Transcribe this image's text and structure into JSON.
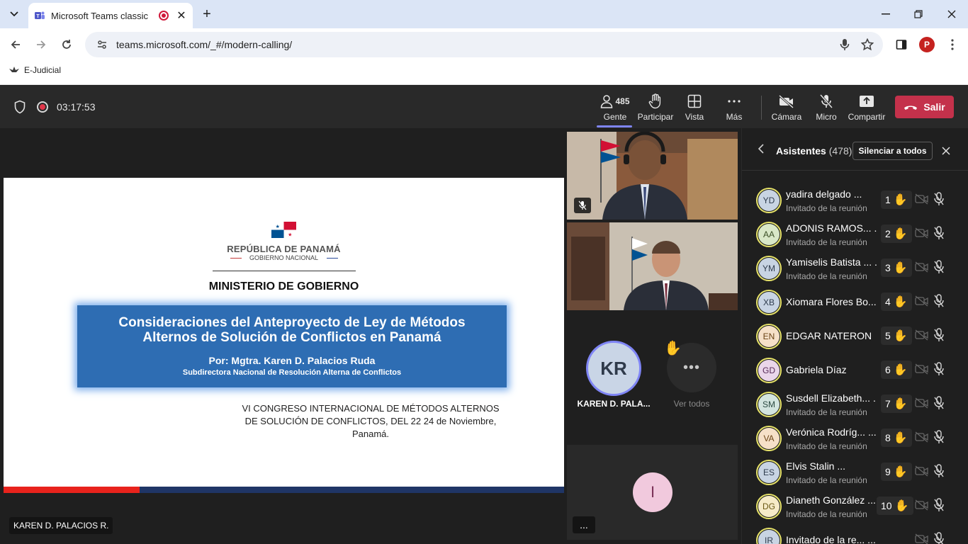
{
  "browser": {
    "tab_title": "Microsoft Teams classic",
    "url": "teams.microsoft.com/_#/modern-calling/",
    "profile_initial": "P",
    "bookmark_label": "E-Judicial"
  },
  "meeting_bar": {
    "timer": "03:17:53",
    "people_count": "485",
    "buttons": {
      "gente": "Gente",
      "participar": "Participar",
      "vista": "Vista",
      "mas": "Más",
      "camara": "Cámara",
      "micro": "Micro",
      "compartir": "Compartir",
      "salir": "Salir"
    }
  },
  "slide": {
    "republica": "REPÚBLICA DE PANAMÁ",
    "gobierno": "GOBIERNO NACIONAL",
    "ministerio": "MINISTERIO DE GOBIERNO",
    "title_line1": "Consideraciones del Anteproyecto de Ley de Métodos",
    "title_line2": "Alternos de Solución de Conflictos en Panamá",
    "author": "Por: Mgtra. Karen D. Palacios Ruda",
    "role": "Subdirectora Nacional de Resolución Alterna de Conflictos",
    "congreso_line1": "VI CONGRESO INTERNACIONAL DE MÉTODOS ALTERNOS",
    "congreso_line2": "DE SOLUCIÓN DE CONFLICTOS, DEL 22 24 de Noviembre,",
    "congreso_line3": "Panamá."
  },
  "presenter_label": "KAREN D. PALACIOS R.",
  "gallery": {
    "kr_initials": "KR",
    "kr_name": "KAREN D. PALA...",
    "ver_todos": "Ver todos",
    "i_initial": "I",
    "more_label": "..."
  },
  "panel": {
    "title": "Asistentes",
    "count": "(478)",
    "mute_all": "Silenciar a todos",
    "attendees": [
      {
        "initials": "YD",
        "name": "yadira delgado ...",
        "sub": "Invitado de la reunión",
        "hand": "1",
        "bg": "#c8d4e3",
        "fg": "#2f3c4d"
      },
      {
        "initials": "AA",
        "name": "ADONIS RAMOS... ...",
        "sub": "Invitado de la reunión",
        "hand": "2",
        "bg": "#d9e8c8",
        "fg": "#3b4f26"
      },
      {
        "initials": "YM",
        "name": "Yamiselis Batista ... ...",
        "sub": "Invitado de la reunión",
        "hand": "3",
        "bg": "#c8d4e3",
        "fg": "#2f3c4d"
      },
      {
        "initials": "XB",
        "name": "Xiomara Flores Bo...",
        "sub": "",
        "hand": "4",
        "bg": "#c8d4e3",
        "fg": "#2f3c4d"
      },
      {
        "initials": "EN",
        "name": "EDGAR NATERON",
        "sub": "",
        "hand": "5",
        "bg": "#f6e0c8",
        "fg": "#6b4416"
      },
      {
        "initials": "GD",
        "name": "Gabriela Díaz",
        "sub": "",
        "hand": "6",
        "bg": "#ead6ea",
        "fg": "#5a2d5a"
      },
      {
        "initials": "SM",
        "name": "Susdell Elizabeth... ...",
        "sub": "Invitado de la reunión",
        "hand": "7",
        "bg": "#d3e4df",
        "fg": "#2c4a42"
      },
      {
        "initials": "VA",
        "name": "Verónica Rodríg... ...",
        "sub": "Invitado de la reunión",
        "hand": "8",
        "bg": "#f6e0c8",
        "fg": "#6b4416"
      },
      {
        "initials": "ES",
        "name": "Elvis Stalin ...",
        "sub": "Invitado de la reunión",
        "hand": "9",
        "bg": "#c8d4e3",
        "fg": "#2f3c4d"
      },
      {
        "initials": "DG",
        "name": "Dianeth González ...",
        "sub": "Invitado de la reunión",
        "hand": "10",
        "bg": "#f6ebc8",
        "fg": "#6b5a16"
      },
      {
        "initials": "IR",
        "name": "Invitado de la re... ...",
        "sub": "",
        "hand": "",
        "bg": "#c8d4e3",
        "fg": "#2f3c4d"
      }
    ]
  }
}
